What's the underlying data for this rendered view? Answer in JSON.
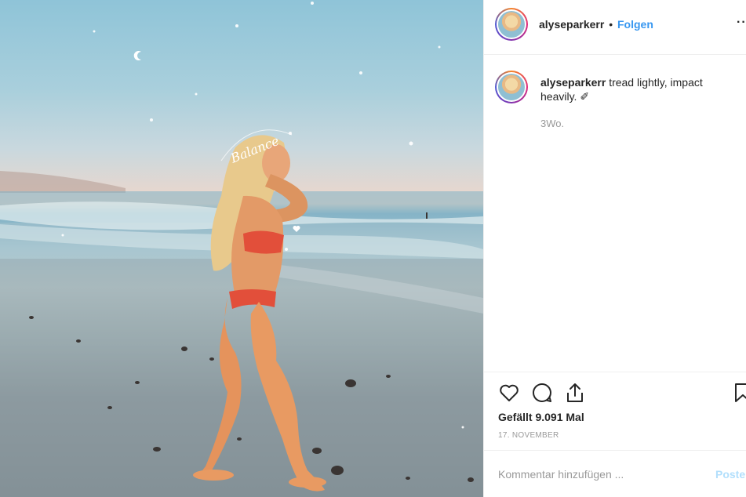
{
  "post": {
    "username": "alyseparkerr",
    "separator": "•",
    "follow_label": "Folgen",
    "more_label": "···"
  },
  "caption": {
    "username": "alyseparkerr",
    "text": "tread lightly, impact heavily. ✐",
    "time_ago": "3Wo."
  },
  "photo_overlay": {
    "script_word": "Balance"
  },
  "actions": {
    "likes_text": "Gefällt 9.091 Mal",
    "date_text": "17. NOVEMBER",
    "icons": [
      "heart-icon",
      "comment-icon",
      "share-icon",
      "bookmark-icon"
    ]
  },
  "comment": {
    "placeholder": "Kommentar hinzufügen ...",
    "post_label": "Posten"
  },
  "colors": {
    "accent": "#3897f0",
    "post_disabled": "#b2dffc",
    "text": "#262626",
    "muted": "#999999"
  }
}
